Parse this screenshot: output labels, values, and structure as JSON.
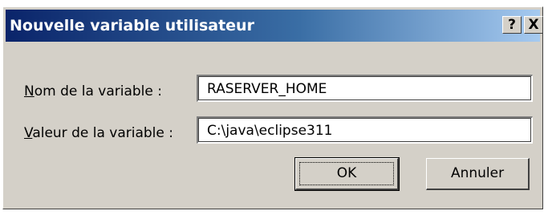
{
  "window": {
    "title": "Nouvelle variable utilisateur",
    "help_label": "?",
    "close_label": "X"
  },
  "form": {
    "name_label_mnemonic": "N",
    "name_label_rest": "om de la variable :",
    "name_value": "RASERVER_HOME",
    "value_label_mnemonic": "V",
    "value_label_rest": "aleur de la variable :",
    "value_value": "C:\\java\\eclipse311"
  },
  "buttons": {
    "ok_label": "OK",
    "cancel_label": "Annuler"
  },
  "colors": {
    "dialog_face": "#d4d0c8",
    "title_start": "#0a246a",
    "title_end": "#a6caf0"
  }
}
